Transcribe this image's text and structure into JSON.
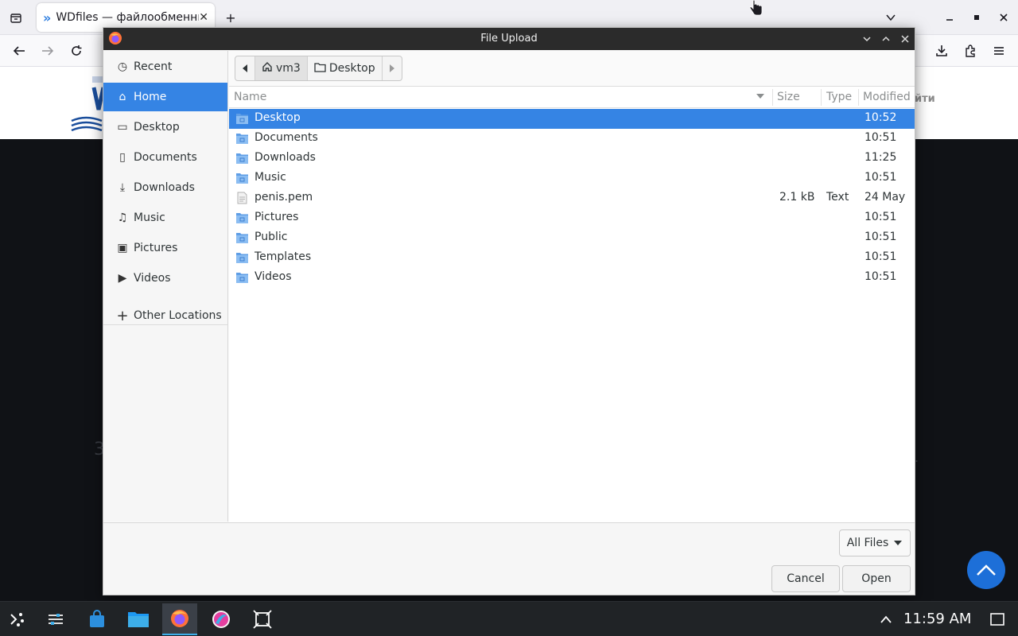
{
  "browser": {
    "tab": {
      "title": "WDfiles — файлообменник",
      "close_label": "✕"
    },
    "new_tab_label": "+",
    "login_text": "йти",
    "bg_char_left": "3",
    "bg_char_right": "."
  },
  "dialog": {
    "title": "File Upload",
    "sidebar": [
      {
        "label": "Recent",
        "icon": "clock-icon",
        "glyph": "◷"
      },
      {
        "label": "Home",
        "icon": "home-icon",
        "glyph": "⌂"
      },
      {
        "label": "Desktop",
        "icon": "folder-icon",
        "glyph": "▭"
      },
      {
        "label": "Documents",
        "icon": "document-icon",
        "glyph": "▯"
      },
      {
        "label": "Downloads",
        "icon": "download-icon",
        "glyph": "⤓"
      },
      {
        "label": "Music",
        "icon": "music-icon",
        "glyph": "♫"
      },
      {
        "label": "Pictures",
        "icon": "picture-icon",
        "glyph": "▣"
      },
      {
        "label": "Videos",
        "icon": "video-icon",
        "glyph": "▶"
      }
    ],
    "other_locations": {
      "label": "Other Locations",
      "glyph": "+"
    },
    "pathbar": {
      "home": "vm3",
      "current": "Desktop"
    },
    "columns": {
      "name": "Name",
      "size": "Size",
      "type": "Type",
      "modified": "Modified"
    },
    "files": [
      {
        "name": "Desktop",
        "size": "",
        "type": "",
        "modified": "10:52",
        "kind": "folder",
        "selected": true
      },
      {
        "name": "Documents",
        "size": "",
        "type": "",
        "modified": "10:51",
        "kind": "folder"
      },
      {
        "name": "Downloads",
        "size": "",
        "type": "",
        "modified": "11:25",
        "kind": "folder"
      },
      {
        "name": "Music",
        "size": "",
        "type": "",
        "modified": "10:51",
        "kind": "folder"
      },
      {
        "name": "penis.pem",
        "size": "2.1 kB",
        "type": "Text",
        "modified": "24 May",
        "kind": "file"
      },
      {
        "name": "Pictures",
        "size": "",
        "type": "",
        "modified": "10:51",
        "kind": "folder"
      },
      {
        "name": "Public",
        "size": "",
        "type": "",
        "modified": "10:51",
        "kind": "folder"
      },
      {
        "name": "Templates",
        "size": "",
        "type": "",
        "modified": "10:51",
        "kind": "folder"
      },
      {
        "name": "Videos",
        "size": "",
        "type": "",
        "modified": "10:51",
        "kind": "folder"
      }
    ],
    "filter": {
      "label": "All Files"
    },
    "cancel_label": "Cancel",
    "open_label": "Open"
  },
  "taskbar": {
    "clock": "11:59 AM"
  },
  "colors": {
    "accent": "#3584e4",
    "dialog_header": "#2b2b2b",
    "taskbar": "#202326"
  }
}
